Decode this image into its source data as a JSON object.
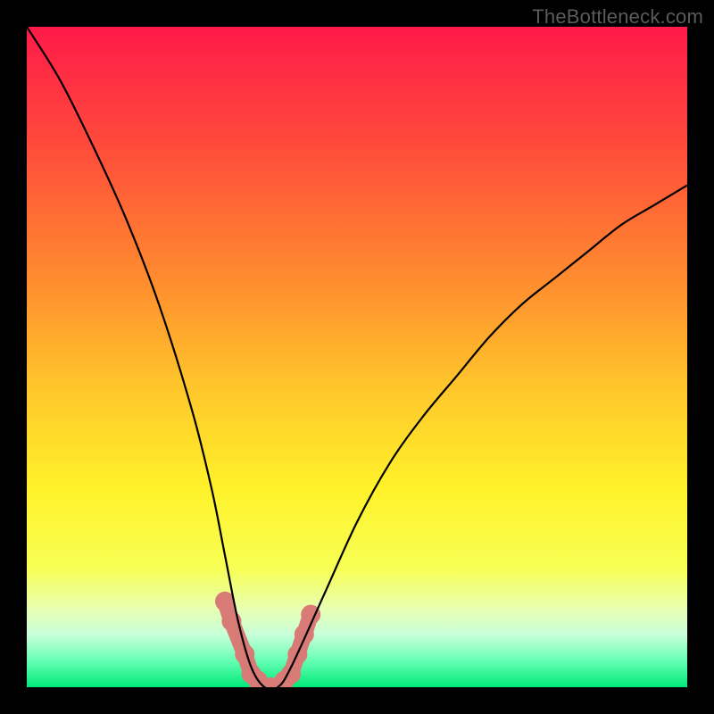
{
  "watermark": "TheBottleneck.com",
  "chart_data": {
    "type": "line",
    "title": "",
    "xlabel": "",
    "ylabel": "",
    "xlim": [
      0,
      100
    ],
    "ylim": [
      0,
      100
    ],
    "x": [
      0,
      5,
      10,
      15,
      20,
      25,
      28,
      30,
      32,
      34,
      36,
      38,
      40,
      45,
      50,
      55,
      60,
      65,
      70,
      75,
      80,
      85,
      90,
      95,
      100
    ],
    "values": [
      100,
      92,
      82,
      71,
      58,
      42,
      30,
      20,
      10,
      3,
      0,
      0,
      3,
      14,
      25,
      34,
      41,
      47,
      53,
      58,
      62,
      66,
      70,
      73,
      76
    ],
    "series_name": "bottleneck_percent",
    "optimal_x": 36,
    "markers": {
      "x": [
        30,
        31,
        33,
        34,
        35,
        36,
        37,
        38,
        39,
        40,
        41,
        42,
        43
      ],
      "y": [
        13,
        10,
        5,
        2,
        1,
        0,
        0,
        0,
        1,
        2,
        5,
        8,
        11
      ],
      "color": "#d87a76"
    },
    "gradient_stops": [
      {
        "offset": 0.0,
        "color": "#ff1a49"
      },
      {
        "offset": 0.18,
        "color": "#ff4b3b"
      },
      {
        "offset": 0.38,
        "color": "#ff8b2f"
      },
      {
        "offset": 0.55,
        "color": "#ffc72b"
      },
      {
        "offset": 0.7,
        "color": "#fff22a"
      },
      {
        "offset": 0.82,
        "color": "#f7ff55"
      },
      {
        "offset": 0.88,
        "color": "#e8ffb0"
      },
      {
        "offset": 0.92,
        "color": "#c9ffda"
      },
      {
        "offset": 0.96,
        "color": "#66ffb3"
      },
      {
        "offset": 1.0,
        "color": "#00e87b"
      }
    ]
  }
}
